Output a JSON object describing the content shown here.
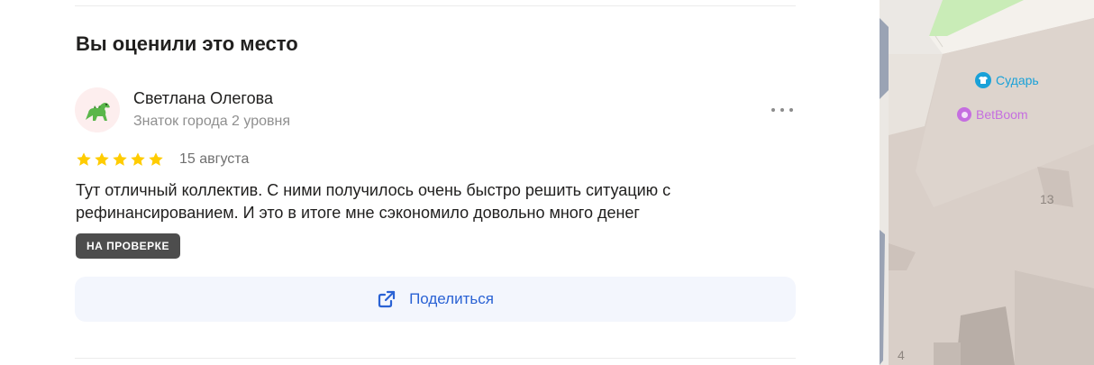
{
  "review_section": {
    "title": "Вы оценили это место",
    "author": {
      "name": "Светлана Олегова",
      "subtitle": "Знаток города 2 уровня",
      "avatar_icon": "dinosaur-icon"
    },
    "rating": 5,
    "rating_max": 5,
    "date": "15 августа",
    "text": "Тут отличный коллектив. С ними получилось очень быстро решить ситуацию с рефинансированием. И это в итоге мне сэкономило довольно много денег",
    "status_badge": "НА ПРОВЕРКЕ",
    "share_label": "Поделиться",
    "colors": {
      "star": "#fc0",
      "badge_bg": "#4d4d4d",
      "share_bg": "#f3f6fd",
      "share_text": "#2a62d4"
    }
  },
  "map": {
    "places": [
      {
        "name": "Сударь",
        "icon": "clothing-icon",
        "color": "#19a1d8"
      },
      {
        "name": "BetBoom",
        "icon": "circle-icon",
        "color": "#c56ee0"
      }
    ],
    "building_number": "13",
    "corner_number": "4"
  }
}
